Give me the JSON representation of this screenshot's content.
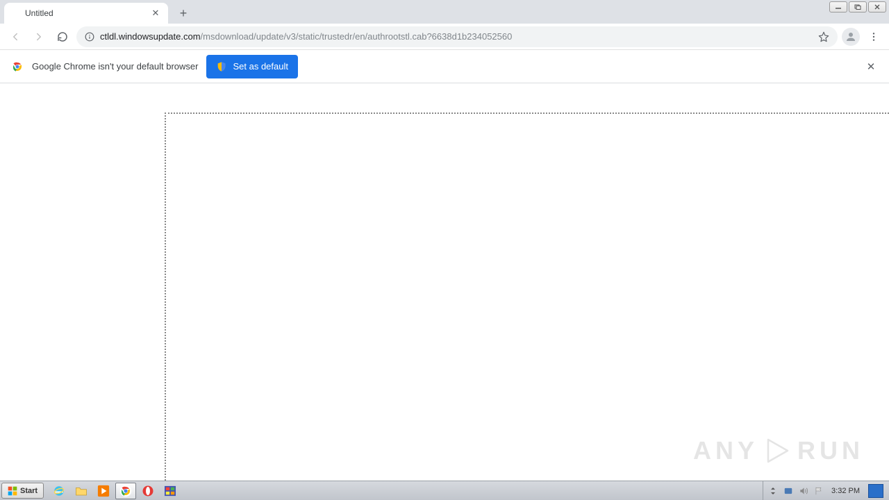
{
  "tab": {
    "title": "Untitled"
  },
  "url": {
    "host": "ctldl.windowsupdate.com",
    "path": "/msdownload/update/v3/static/trustedr/en/authrootstl.cab?6638d1b234052560"
  },
  "infobar": {
    "message": "Google Chrome isn't your default browser",
    "button": "Set as default"
  },
  "watermark": {
    "left": "ANY",
    "right": "RUN"
  },
  "taskbar": {
    "start": "Start",
    "clock": "3:32 PM"
  }
}
